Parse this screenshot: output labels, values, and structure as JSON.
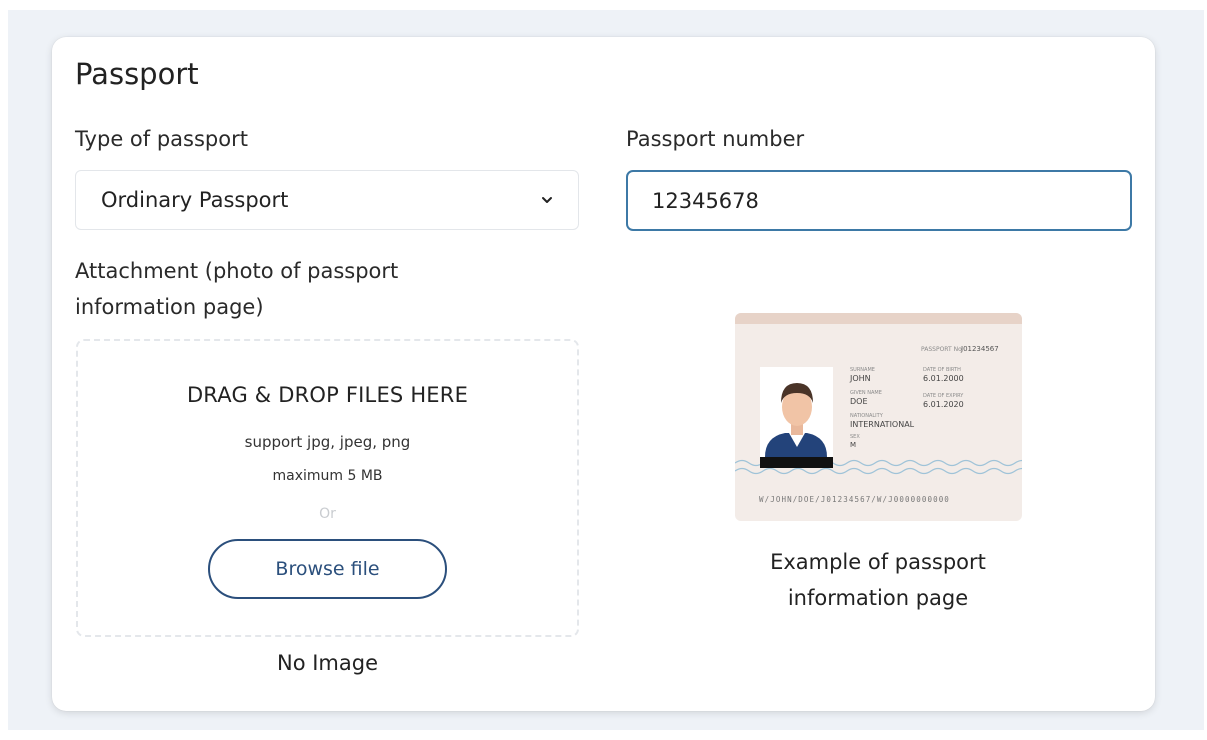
{
  "card": {
    "title": "Passport"
  },
  "passport_type": {
    "label": "Type of passport",
    "selected": "Ordinary Passport"
  },
  "passport_number": {
    "label": "Passport number",
    "value": "12345678"
  },
  "attachment": {
    "label_line1": "Attachment (photo of passport",
    "label_line2": "information page)",
    "drop_title": "DRAG & DROP FILES HERE",
    "support_text": "support jpg, jpeg, png",
    "max_size_text": "maximum 5 MB",
    "or_text": "Or",
    "browse_label": "Browse file",
    "status": "No Image"
  },
  "example": {
    "caption_line1": "Example of passport",
    "caption_line2": "information page",
    "passport_no_label": "PASSPORT No",
    "passport_no": "J01234567",
    "surname_label": "SURNAME",
    "surname": "JOHN",
    "given_label": "GIVEN NAME",
    "given": "DOE",
    "nationality_label": "NATIONALITY",
    "nationality": "INTERNATIONAL",
    "sex_label": "SEX",
    "sex": "M",
    "dob_label": "DATE OF BIRTH",
    "dob": "6.01.2000",
    "doe_label": "DATE OF EXPIRY",
    "doe": "6.01.2020",
    "mrz": "W/JOHN/DOE/J01234567/W/J0000000000"
  },
  "colors": {
    "accent": "#3d79a6",
    "button": "#2b4f7c",
    "backdrop": "#eef2f7"
  },
  "icons": {
    "select_chevron": "chevron-down-icon"
  }
}
